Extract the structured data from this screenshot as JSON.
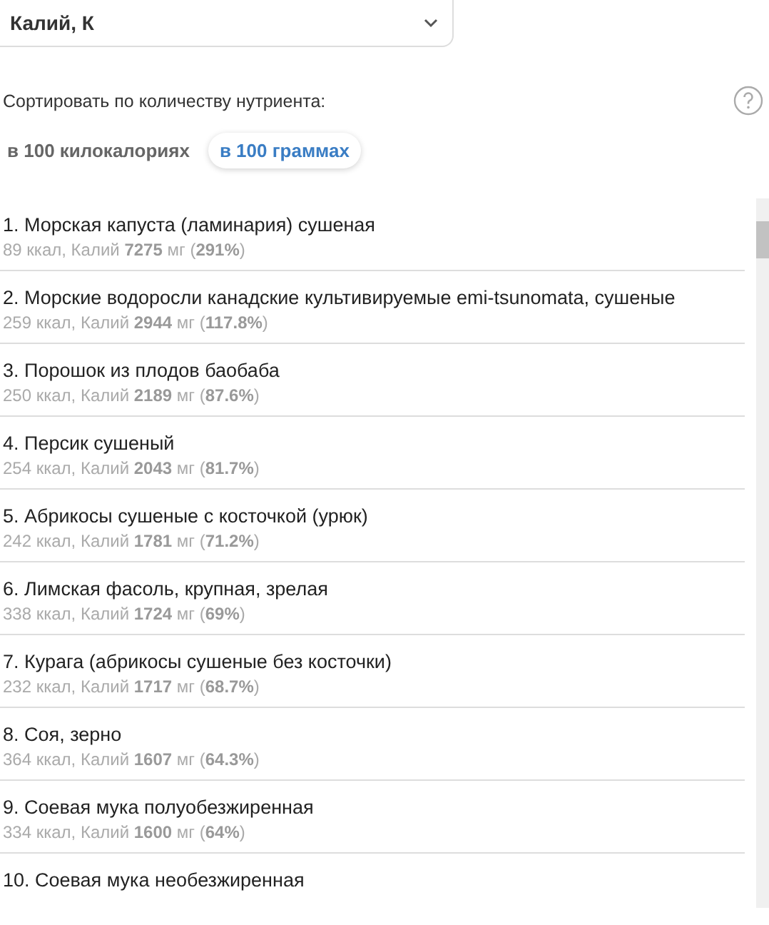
{
  "nutrient_select": {
    "value": "Калий, К"
  },
  "sort_label": "Сортировать по количеству нутриента:",
  "sort_options": [
    {
      "label": "в 100 килокалориях",
      "selected": false
    },
    {
      "label": "в 100 граммах",
      "selected": true
    }
  ],
  "foods": [
    {
      "name": "1. Морская капуста (ламинария) сушеная",
      "details": "89 ккал, Калий **7275** мг (**291%**)"
    },
    {
      "name": "2. Морские водоросли канадские культивируемые emi-tsunomata, сушеные",
      "details": "259 ккал, Калий **2944** мг (**117.8%**)"
    },
    {
      "name": "3. Порошок из плодов баобаба",
      "details": "250 ккал, Калий **2189** мг (**87.6%**)"
    },
    {
      "name": "4. Персик сушеный",
      "details": "254 ккал, Калий **2043** мг (**81.7%**)"
    },
    {
      "name": "5. Абрикосы сушеные с косточкой (урюк)",
      "details": "242 ккал, Калий **1781** мг (**71.2%**)"
    },
    {
      "name": "6. Лимская фасоль, крупная, зрелая",
      "details": "338 ккал, Калий **1724** мг (**69%**)"
    },
    {
      "name": "7. Курага (абрикосы сушеные без косточки)",
      "details": "232 ккал, Калий **1717** мг (**68.7%**)"
    },
    {
      "name": "8. Соя, зерно",
      "details": "364 ккал, Калий **1607** мг (**64.3%**)"
    },
    {
      "name": "9. Соевая мука полуобезжиренная",
      "details": "334 ккал, Калий **1600** мг (**64%**)"
    },
    {
      "name": "10. Соевая мука необезжиренная"
    }
  ]
}
